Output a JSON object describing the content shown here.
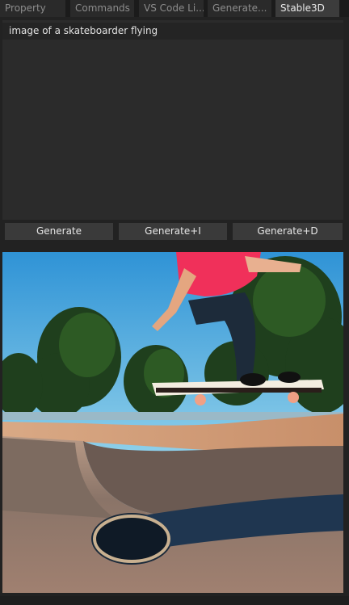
{
  "tabs": [
    {
      "label": "Property"
    },
    {
      "label": "Commands"
    },
    {
      "label": "VS Code Li..."
    },
    {
      "label": "Generate..."
    },
    {
      "label": "Stable3D",
      "active": true
    }
  ],
  "prompt": {
    "value": "image of a skateboarder flying"
  },
  "buttons": {
    "generate": "Generate",
    "generate_i": "Generate+I",
    "generate_d": "Generate+D"
  },
  "image": {
    "subject": "skateboarder performing a trick over a concrete skate bowl"
  },
  "colors": {
    "active_tab": "#3c3c3c",
    "panel": "#2b2b2b",
    "button": "#3a3a3a"
  }
}
